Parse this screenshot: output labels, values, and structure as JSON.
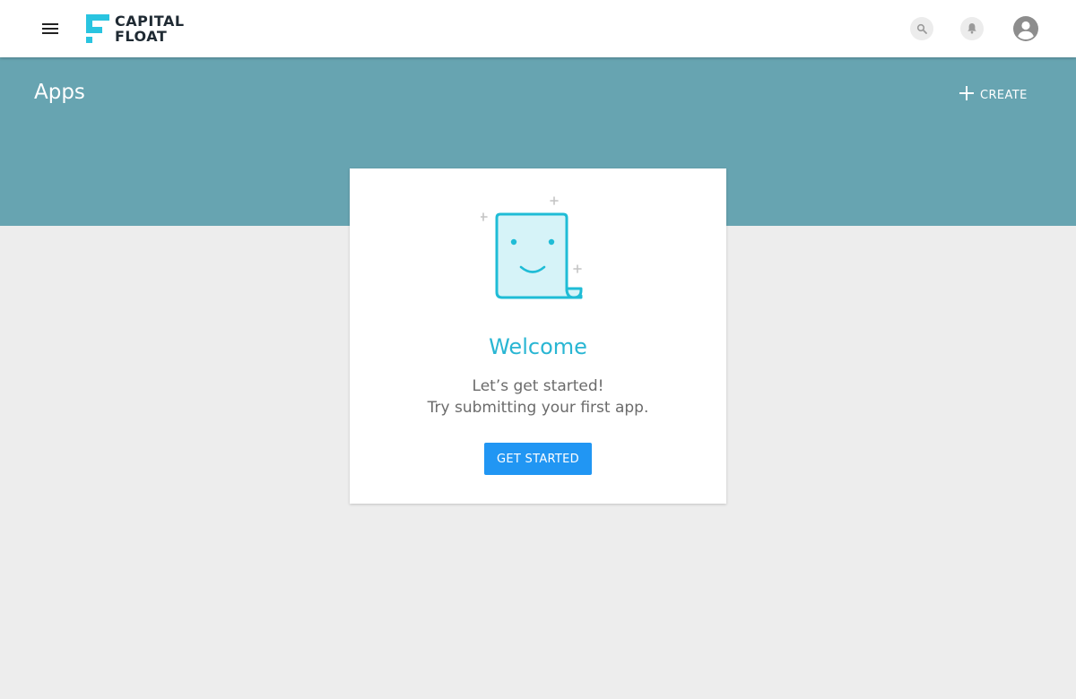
{
  "header": {
    "logo_line1": "CAPITAL",
    "logo_line2": "FLOAT",
    "icons": {
      "menu": "menu-icon",
      "search": "search-icon",
      "notifications": "bell-icon",
      "account": "account-circle-icon"
    }
  },
  "banner": {
    "title": "Apps",
    "create_label": "CREATE",
    "create_icon": "plus-icon"
  },
  "welcome_card": {
    "illustration": "smiling-document-illustration",
    "heading": "Welcome",
    "line1": "Let’s get started!",
    "line2": "Try submitting your first app.",
    "button_label": "GET STARTED"
  },
  "colors": {
    "accent_cyan": "#29b6d3",
    "banner": "#67a4b1",
    "primary_button": "#2196f3",
    "background": "#ededed"
  }
}
